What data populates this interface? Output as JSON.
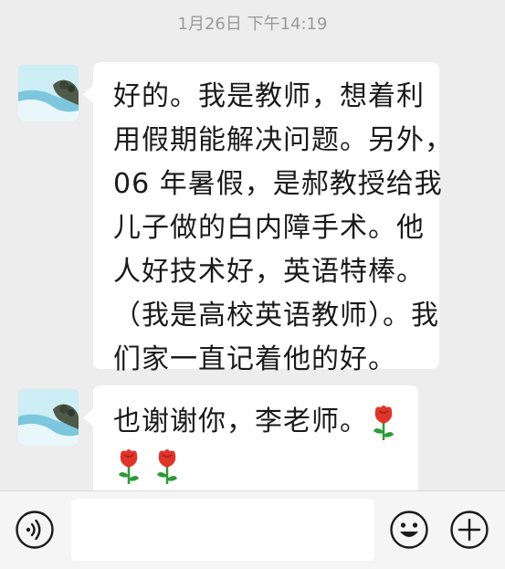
{
  "timestamp": "1月26日 下午14:19",
  "messages": [
    {
      "lines": [
        "好的。我是教师，想着利",
        "用假期能解决问题。另外，",
        "06 年暑假，是郝教授给我",
        "儿子做的白内障手术。他",
        "人好技术好，英语特棒。",
        "（我是高校英语教师）。我",
        "们家一直记着他的好。"
      ]
    },
    {
      "text": "也谢谢你，李老师。",
      "emoji": "rose-emoji"
    }
  ],
  "input_bar": {
    "voice_icon": "voice-icon",
    "text_value": "",
    "emoji_icon": "emoji-icon",
    "plus_icon": "plus-icon"
  },
  "colors": {
    "background": "#ededed",
    "bubble": "#ffffff",
    "text": "#1a1a1a",
    "timestamp": "#9a9a9a",
    "icon": "#1a1a1a",
    "rose": "#e0352b",
    "leaf": "#2f9a3a"
  }
}
